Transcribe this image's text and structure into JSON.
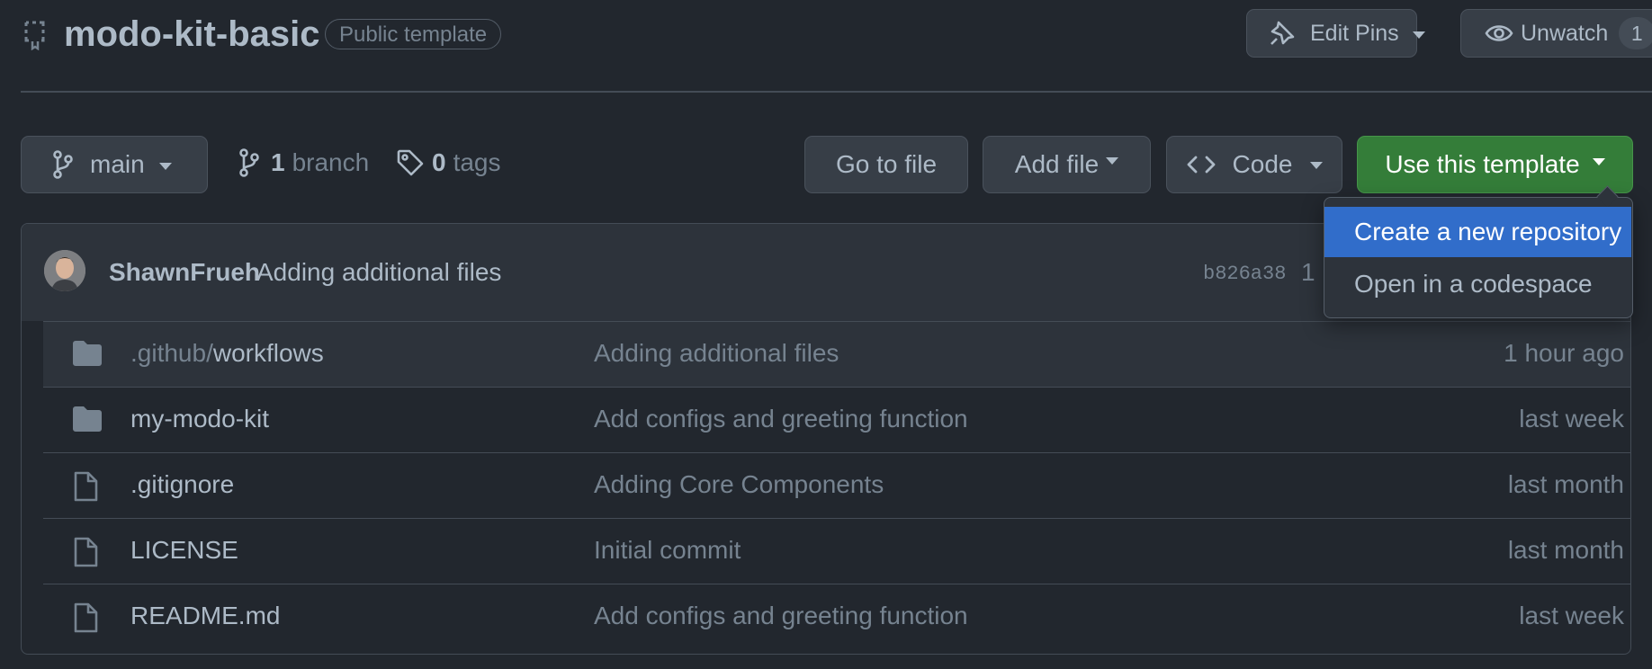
{
  "repo": {
    "name": "modo-kit-basic",
    "visibility_badge": "Public template"
  },
  "header_actions": {
    "edit_pins_label": "Edit Pins",
    "unwatch_label": "Unwatch",
    "watch_count": "1"
  },
  "toolbar": {
    "branch_name": "main",
    "branch_count": "1",
    "branch_label": "branch",
    "tag_count": "0",
    "tag_label": "tags",
    "go_to_file_label": "Go to file",
    "add_file_label": "Add file",
    "code_label": "Code",
    "use_template_label": "Use this template",
    "accent_color": "#347d39"
  },
  "template_menu": {
    "items": [
      {
        "label": "Create a new repository",
        "selected": true
      },
      {
        "label": "Open in a codespace",
        "selected": false
      }
    ],
    "highlight_color": "#316dca"
  },
  "latest_commit": {
    "author": "ShawnFrueh",
    "message": "Adding additional files",
    "sha": "b826a38",
    "extra": "1"
  },
  "files": [
    {
      "type": "folder",
      "name_prefix": ".github/",
      "name": "workflows",
      "message": "Adding additional files",
      "age": "1 hour ago"
    },
    {
      "type": "folder",
      "name_prefix": "",
      "name": "my-modo-kit",
      "message": "Add configs and greeting function",
      "age": "last week"
    },
    {
      "type": "file",
      "name_prefix": "",
      "name": ".gitignore",
      "message": "Adding Core Components",
      "age": "last month"
    },
    {
      "type": "file",
      "name_prefix": "",
      "name": "LICENSE",
      "message": "Initial commit",
      "age": "last month"
    },
    {
      "type": "file",
      "name_prefix": "",
      "name": "README.md",
      "message": "Add configs and greeting function",
      "age": "last week"
    }
  ]
}
